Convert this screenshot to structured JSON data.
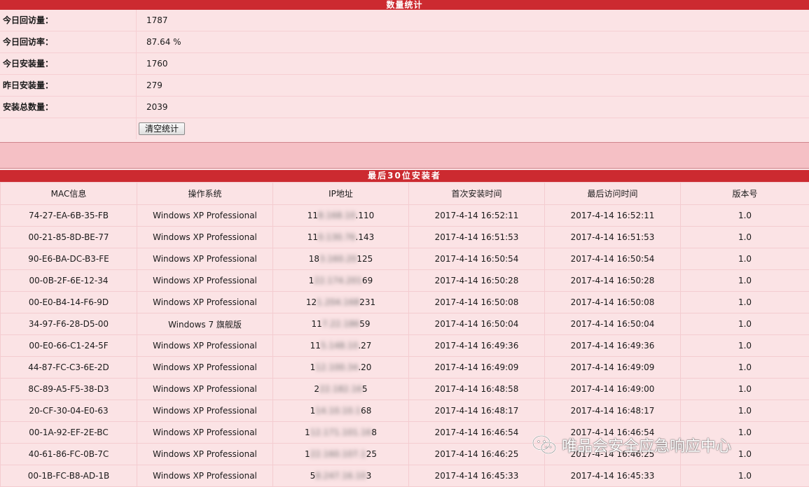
{
  "stats": {
    "title": "数量统计",
    "rows": [
      {
        "label": "今日回访量：",
        "value": "1787"
      },
      {
        "label": "今日回访率：",
        "value": "87.64 %"
      },
      {
        "label": "今日安装量：",
        "value": "1760"
      },
      {
        "label": "昨日安装量：",
        "value": "279"
      },
      {
        "label": "安装总数量：",
        "value": "2039"
      }
    ],
    "clear_button": "清空统计"
  },
  "installs": {
    "title": "最后30位安装者",
    "columns": [
      "MAC信息",
      "操作系统",
      "IP地址",
      "首次安装时间",
      "最后访问时间",
      "版本号"
    ],
    "rows": [
      {
        "mac": "74-27-EA-6B-35-FB",
        "os": "Windows XP Professional",
        "ip_start": "11",
        "ip_mask": "8.168.10",
        "ip_end": ".110",
        "first": "2017-4-14 16:52:11",
        "last": "2017-4-14 16:52:11",
        "ver": "1.0"
      },
      {
        "mac": "00-21-85-8D-BE-77",
        "os": "Windows XP Professional",
        "ip_start": "11",
        "ip_mask": "0.130.76",
        "ip_end": ".143",
        "first": "2017-4-14 16:51:53",
        "last": "2017-4-14 16:51:53",
        "ver": "1.0"
      },
      {
        "mac": "90-E6-BA-DC-B3-FE",
        "os": "Windows XP Professional",
        "ip_start": "18",
        "ip_mask": "3.160.20",
        "ip_end": "125",
        "first": "2017-4-14 16:50:54",
        "last": "2017-4-14 16:50:54",
        "ver": "1.0"
      },
      {
        "mac": "00-0B-2F-6E-12-34",
        "os": "Windows XP Professional",
        "ip_start": "1",
        "ip_mask": "22.174.201",
        "ip_end": "69",
        "first": "2017-4-14 16:50:28",
        "last": "2017-4-14 16:50:28",
        "ver": "1.0"
      },
      {
        "mac": "00-E0-B4-14-F6-9D",
        "os": "Windows XP Professional",
        "ip_start": "12",
        "ip_mask": "1.204.168",
        "ip_end": "231",
        "first": "2017-4-14 16:50:08",
        "last": "2017-4-14 16:50:08",
        "ver": "1.0"
      },
      {
        "mac": "34-97-F6-28-D5-00",
        "os": "Windows 7 旗舰版",
        "ip_start": "11",
        "ip_mask": "7.22.186",
        "ip_end": "59",
        "first": "2017-4-14 16:50:04",
        "last": "2017-4-14 16:50:04",
        "ver": "1.0"
      },
      {
        "mac": "00-E0-66-C1-24-5F",
        "os": "Windows XP Professional",
        "ip_start": "11",
        "ip_mask": "5.148.10",
        "ip_end": ".27",
        "first": "2017-4-14 16:49:36",
        "last": "2017-4-14 16:49:36",
        "ver": "1.0"
      },
      {
        "mac": "44-87-FC-C3-6E-2D",
        "os": "Windows XP Professional",
        "ip_start": "1",
        "ip_mask": "12.100.34",
        "ip_end": ".20",
        "first": "2017-4-14 16:49:09",
        "last": "2017-4-14 16:49:09",
        "ver": "1.0"
      },
      {
        "mac": "8C-89-A5-F5-38-D3",
        "os": "Windows XP Professional",
        "ip_start": "2",
        "ip_mask": "22.182.16",
        "ip_end": "5",
        "first": "2017-4-14 16:48:58",
        "last": "2017-4-14 16:49:00",
        "ver": "1.0"
      },
      {
        "mac": "20-CF-30-04-E0-63",
        "os": "Windows XP Professional",
        "ip_start": "1",
        "ip_mask": "14.10.10.1",
        "ip_end": "68",
        "first": "2017-4-14 16:48:17",
        "last": "2017-4-14 16:48:17",
        "ver": "1.0"
      },
      {
        "mac": "00-1A-92-EF-2E-BC",
        "os": "Windows XP Professional",
        "ip_start": "1",
        "ip_mask": "12.171.101.16",
        "ip_end": "8",
        "first": "2017-4-14 16:46:54",
        "last": "2017-4-14 16:46:54",
        "ver": "1.0"
      },
      {
        "mac": "40-61-86-FC-0B-7C",
        "os": "Windows XP Professional",
        "ip_start": "1",
        "ip_mask": "22.160.107.1",
        "ip_end": "25",
        "first": "2017-4-14 16:46:25",
        "last": "2017-4-14 16:46:25",
        "ver": "1.0"
      },
      {
        "mac": "00-1B-FC-B8-AD-1B",
        "os": "Windows XP Professional",
        "ip_start": "5",
        "ip_mask": "8.247.16.10",
        "ip_end": "3",
        "first": "2017-4-14 16:45:33",
        "last": "2017-4-14 16:45:33",
        "ver": "1.0"
      }
    ]
  },
  "watermark": {
    "text": "唯品会安全应急响应中心",
    "icon": "wechat-icon"
  },
  "colors": {
    "header_red": "#cc2a30",
    "row_pink": "#fbe3e5",
    "separator_pink": "#f5c0c5"
  }
}
